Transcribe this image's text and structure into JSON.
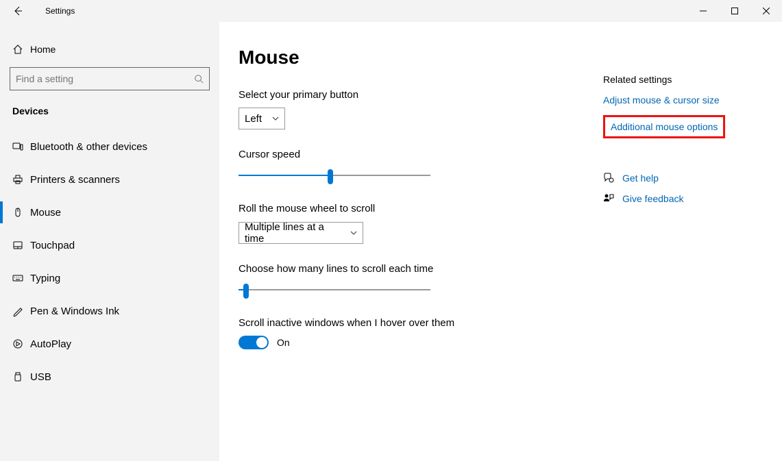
{
  "window": {
    "title": "Settings"
  },
  "sidebar": {
    "home": "Home",
    "search_placeholder": "Find a setting",
    "section": "Devices",
    "items": [
      {
        "label": "Bluetooth & other devices"
      },
      {
        "label": "Printers & scanners"
      },
      {
        "label": "Mouse"
      },
      {
        "label": "Touchpad"
      },
      {
        "label": "Typing"
      },
      {
        "label": "Pen & Windows Ink"
      },
      {
        "label": "AutoPlay"
      },
      {
        "label": "USB"
      }
    ]
  },
  "main": {
    "title": "Mouse",
    "primary_label": "Select your primary button",
    "primary_value": "Left",
    "cursor_speed_label": "Cursor speed",
    "scroll_label": "Roll the mouse wheel to scroll",
    "scroll_value": "Multiple lines at a time",
    "lines_label": "Choose how many lines to scroll each time",
    "inactive_label": "Scroll inactive windows when I hover over them",
    "inactive_value": "On"
  },
  "right": {
    "related_heading": "Related settings",
    "adjust_link": "Adjust mouse & cursor size",
    "additional_link": "Additional mouse options",
    "get_help": "Get help",
    "give_feedback": "Give feedback"
  }
}
